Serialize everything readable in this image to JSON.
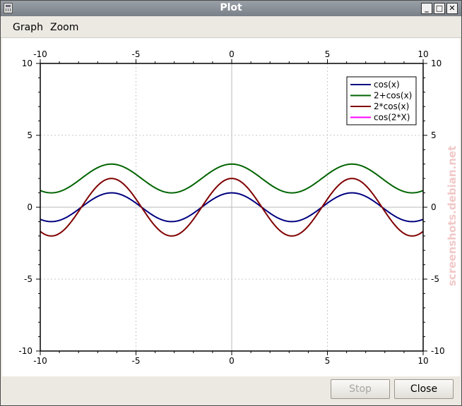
{
  "window": {
    "title": "Plot",
    "controls": {
      "minimize": "_",
      "maximize": "□",
      "close": "✕"
    }
  },
  "menu": [
    {
      "label": "Graph"
    },
    {
      "label": "Zoom"
    }
  ],
  "buttons": {
    "stop": "Stop",
    "close": "Close"
  },
  "watermark": "screenshots.debian.net",
  "chart_data": {
    "type": "line",
    "xlim": [
      -10,
      10
    ],
    "ylim": [
      -10,
      10
    ],
    "x_ticks": [
      -10,
      -5,
      0,
      5,
      10
    ],
    "y_ticks": [
      -10,
      -5,
      0,
      5,
      10
    ],
    "grid": true,
    "legend_position": "top-right",
    "series": [
      {
        "name": "cos(x)",
        "expression": "cos(x)",
        "color": "#000080"
      },
      {
        "name": "2+cos(x)",
        "expression": "2+cos(x)",
        "color": "#006400"
      },
      {
        "name": "2*cos(x)",
        "expression": "2*cos(x)",
        "color": "#800000"
      },
      {
        "name": "cos(2*X)",
        "expression": "cos(2*X)",
        "color": "#ff00ff",
        "visible": false
      }
    ]
  }
}
